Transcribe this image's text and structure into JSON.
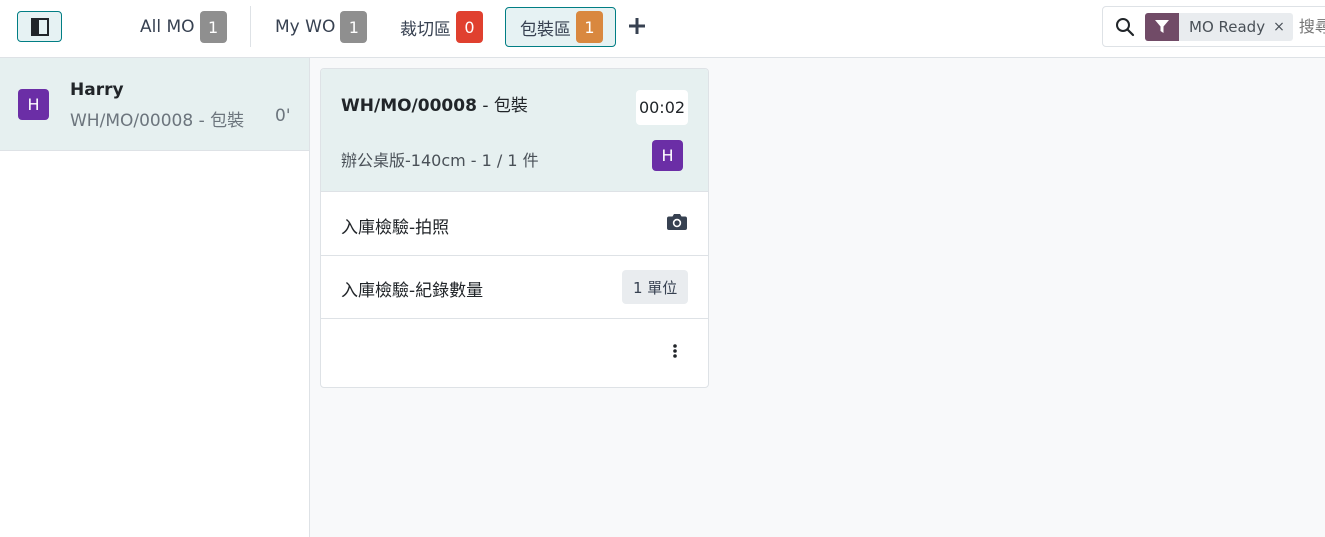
{
  "tabs": [
    {
      "label": "All MO",
      "count": "1",
      "color": "#8f8f8f"
    },
    {
      "label": "My WO",
      "count": "1",
      "color": "#8f8f8f"
    },
    {
      "label": "裁切區",
      "count": "0",
      "color": "#e0402f"
    },
    {
      "label": "包裝區",
      "count": "1",
      "color": "#d9883f",
      "active": true
    }
  ],
  "icons": {
    "panel_toggle": "panel-toggle-icon",
    "add": "plus-icon",
    "search": "search-icon",
    "filter": "filter-icon",
    "camera": "camera-icon",
    "more": "kebab-menu-icon"
  },
  "search": {
    "facet_label": "MO Ready",
    "facet_remove": "×",
    "placeholder": "搜尋…",
    "visible_text": "搜尋"
  },
  "employee_panel": {
    "employee": {
      "avatar_initial": "H",
      "name": "Harry",
      "workorder": "WH/MO/00008 - 包裝",
      "time": "0'"
    }
  },
  "workorder_card": {
    "mo_ref": "WH/MO/00008",
    "operation": " - 包裝",
    "timer": "00:02",
    "product_line": "辦公桌版-140cm - 1 / 1 件",
    "avatar_initial": "H",
    "steps": [
      {
        "label": "入庫檢驗-拍照",
        "action": "camera"
      },
      {
        "label": "入庫檢驗-紀錄數量",
        "action": "quantity",
        "quantity": "1 單位"
      }
    ]
  },
  "colors": {
    "accent": "#017e84",
    "accent_light": "#e6f2f3",
    "selected_row": "#e6f0f0",
    "avatar": "#6b2ea6",
    "facet": "#714b67"
  }
}
